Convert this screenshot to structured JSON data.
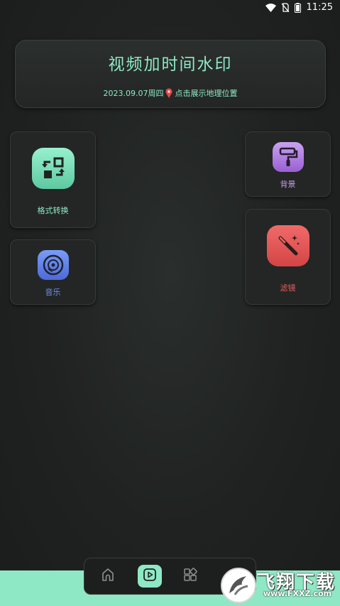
{
  "status_bar": {
    "time": "11:25"
  },
  "header": {
    "title": "视频加时间水印",
    "date_text": "2023.09.07周四",
    "location_text": "点击展示地理位置"
  },
  "tools": {
    "format_convert": {
      "label": "格式转换",
      "color": "#8fe8c5"
    },
    "music": {
      "label": "音乐",
      "color": "#6d8ff0"
    },
    "background": {
      "label": "背景",
      "color": "#c59ce8"
    },
    "filter": {
      "label": "滤镜",
      "color": "#e85c5c"
    }
  },
  "nav": {
    "items": [
      {
        "name": "home",
        "icon": "home-icon"
      },
      {
        "name": "video",
        "icon": "play-icon",
        "active": true
      },
      {
        "name": "apps",
        "icon": "apps-icon"
      }
    ]
  },
  "watermark": {
    "title": "飞翔下载",
    "url": "www.FXXZ.com"
  }
}
